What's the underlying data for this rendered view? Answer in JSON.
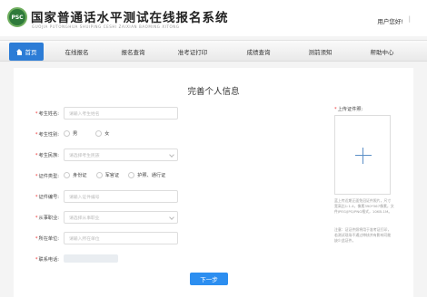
{
  "header": {
    "logo_text": "PSC",
    "title": "国家普通话水平测试在线报名系统",
    "subtitle": "GUOJIA PUTONGHUA SHUIPING CESHI ZAIXIAN BAOMING XITONG",
    "greeting": "用户您好!",
    "separator": "|"
  },
  "nav": {
    "items": [
      {
        "label": "首页",
        "active": true
      },
      {
        "label": "在线报名"
      },
      {
        "label": "报名查询"
      },
      {
        "label": "准考证打印"
      },
      {
        "label": "成绩查询"
      },
      {
        "label": "测前须知"
      },
      {
        "label": "帮助中心"
      }
    ]
  },
  "form": {
    "title": "完善个人信息",
    "required_mark": "*",
    "name": {
      "label": "考生姓名:",
      "placeholder": "请输入考生姓名"
    },
    "gender": {
      "label": "考生性别:",
      "options": [
        "男",
        "女"
      ]
    },
    "ethnicity": {
      "label": "考生民族:",
      "placeholder": "请选择考生民族"
    },
    "id_type": {
      "label": "证件类型:",
      "options": [
        "身份证",
        "军官证",
        "护照、通行证"
      ]
    },
    "id_number": {
      "label": "证件编号:",
      "placeholder": "请输入证件编号"
    },
    "occupation": {
      "label": "从事职业:",
      "placeholder": "请选择从事职业"
    },
    "employer": {
      "label": "所在单位:",
      "placeholder": "请输入所在单位"
    },
    "phone": {
      "label": "联系电话:"
    },
    "upload": {
      "label": "上传证件照:",
      "hint1": "蓝上传近期正面免冠证件照片，尺寸宽高比1:1.4，像素390*567像素，文件JPEG/JPG/PNG格式，10KB-1M。",
      "hint2": "注意：证证件照将用于准考证打印，若测试现场不通过审核并有影响可能缺少此证件。"
    },
    "next_button": "下一步"
  }
}
